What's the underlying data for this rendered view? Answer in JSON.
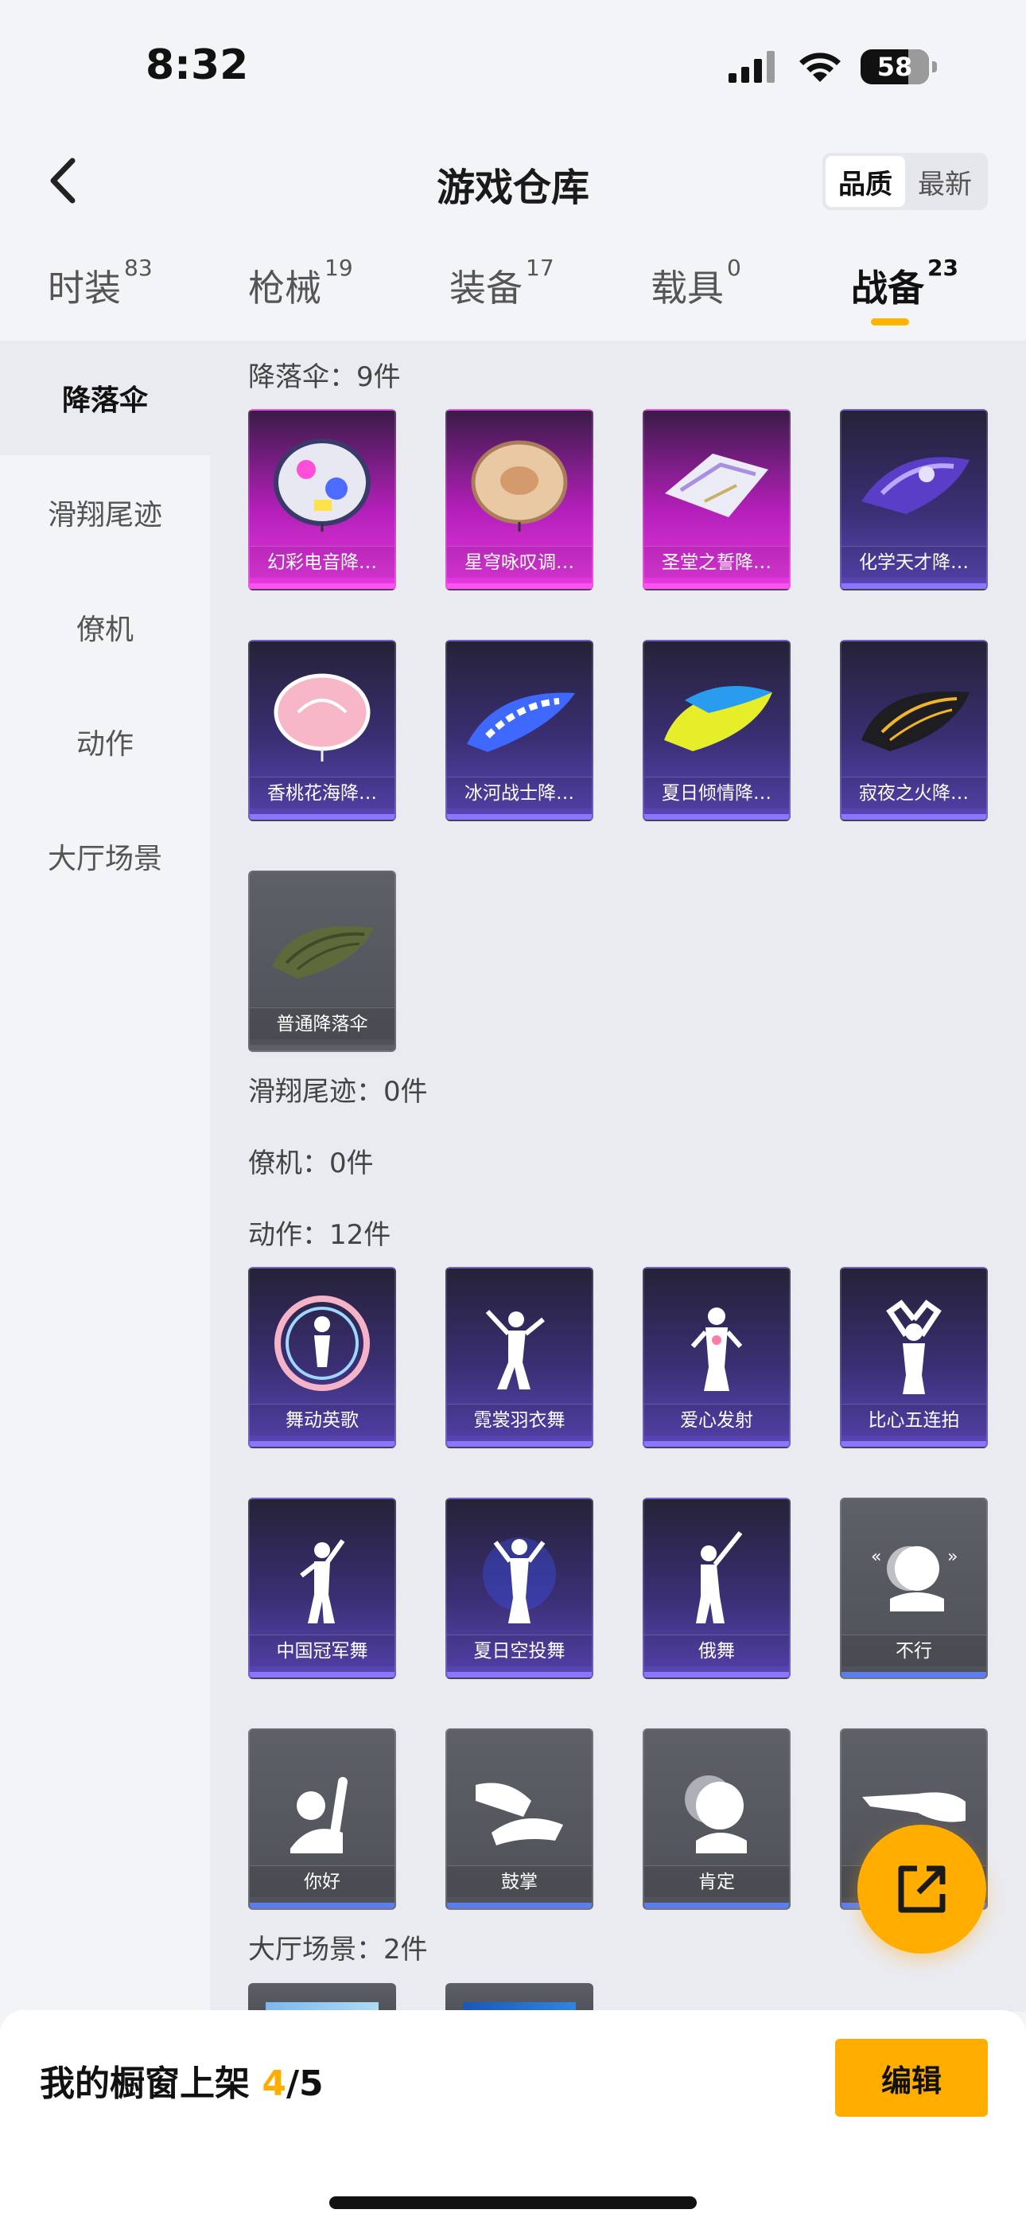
{
  "status": {
    "time": "8:32",
    "battery": "58"
  },
  "header": {
    "title": "游戏仓库",
    "sort": {
      "options": [
        "品质",
        "最新"
      ],
      "active": "品质"
    }
  },
  "tabs": [
    {
      "label": "时装",
      "count": "83"
    },
    {
      "label": "枪械",
      "count": "19"
    },
    {
      "label": "装备",
      "count": "17"
    },
    {
      "label": "载具",
      "count": "0"
    },
    {
      "label": "战备",
      "count": "23",
      "active": true
    }
  ],
  "sidebar": {
    "items": [
      "降落伞",
      "滑翔尾迹",
      "僚机",
      "动作",
      "大厅场景"
    ],
    "active": "降落伞"
  },
  "sections": {
    "parachute": {
      "label": "降落伞：9件",
      "items": [
        "幻彩电音降…",
        "星穹咏叹调…",
        "圣堂之誓降…",
        "化学天才降…",
        "香桃花海降…",
        "冰河战士降…",
        "夏日倾情降…",
        "寂夜之火降…",
        "普通降落伞"
      ]
    },
    "glide_trail": {
      "label": "滑翔尾迹：0件"
    },
    "wingman": {
      "label": "僚机：0件"
    },
    "emote": {
      "label": "动作：12件",
      "items": [
        "舞动英歌",
        "霓裳羽衣舞",
        "爱心发射",
        "比心五连拍",
        "中国冠军舞",
        "夏日空投舞",
        "俄舞",
        "不行",
        "你好",
        "鼓掌",
        "肯定",
        ""
      ]
    },
    "lobby": {
      "label": "大厅场景：2件"
    }
  },
  "bottom": {
    "showcase_prefix": "我的橱窗上架",
    "showcase_count": "4",
    "showcase_total": "/5",
    "edit_label": "编辑"
  },
  "colors": {
    "accent": "#ffae00",
    "legendary": "#ff53f0",
    "epic": "#8a76ff"
  }
}
